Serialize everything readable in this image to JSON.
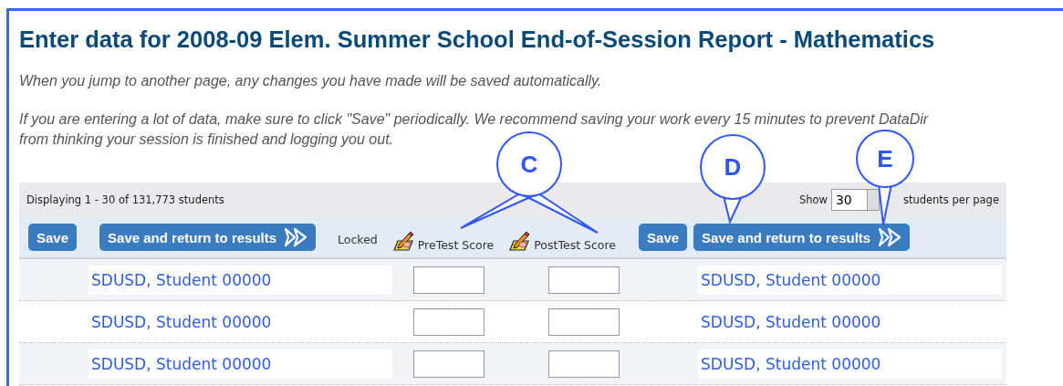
{
  "title": "Enter data for 2008-09 Elem. Summer School End-of-Session Report - Mathematics",
  "notes": [
    "When you jump to another page, any changes you have made will be saved automatically.",
    "If you are entering a lot of data, make sure to click \"Save\" periodically. We recommend saving your work every 15 minutes to prevent DataDir\nfrom thinking your session is finished and logging you out."
  ],
  "panel": {
    "displaying": "Displaying 1 - 30 of 131,773 students",
    "show_label": "Show",
    "per_page": "30",
    "per_page_suffix": "students per page"
  },
  "toolbar": {
    "save": "Save",
    "save_return": "Save and return to results",
    "locked": "Locked",
    "columns": [
      "PreTest Score",
      "PostTest Score"
    ],
    "save_right": "Save",
    "save_return_right": "Save and return to results"
  },
  "rows": [
    {
      "name": "SDUSD, Student 00000",
      "pretest": "",
      "posttest": "",
      "name_right": "SDUSD, Student 00000"
    },
    {
      "name": "SDUSD, Student 00000",
      "pretest": "",
      "posttest": "",
      "name_right": "SDUSD, Student 00000"
    },
    {
      "name": "SDUSD, Student 00000",
      "pretest": "",
      "posttest": "",
      "name_right": "SDUSD, Student 00000"
    }
  ],
  "callouts": [
    {
      "label": "C"
    },
    {
      "label": "D"
    },
    {
      "label": "E"
    }
  ]
}
